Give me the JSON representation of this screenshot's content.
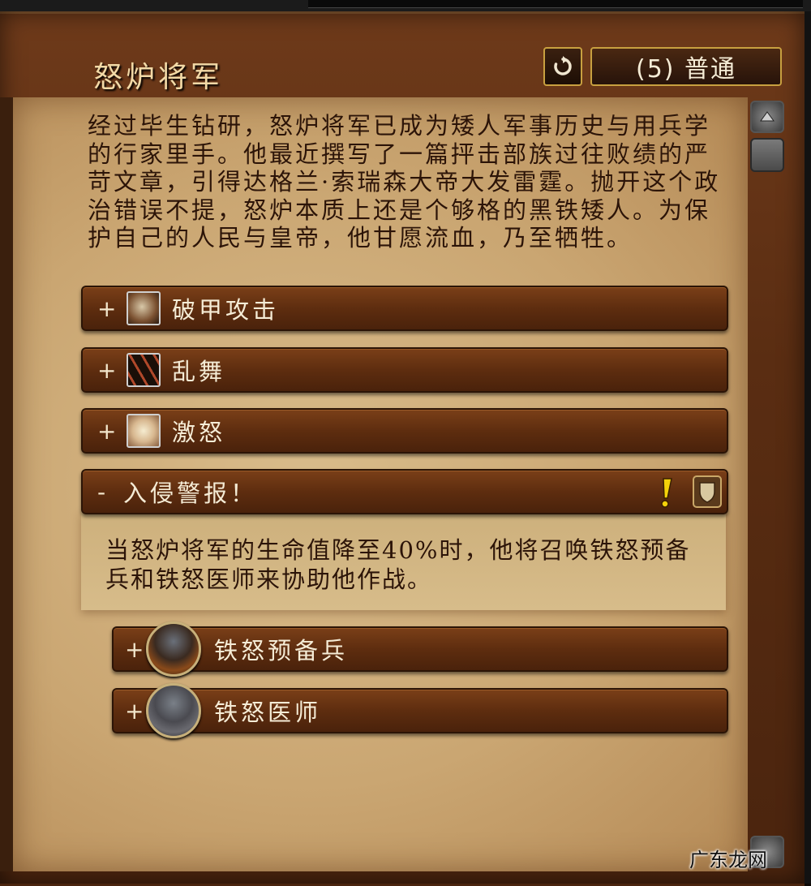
{
  "header": {
    "title": "怒炉将军",
    "difficulty_label": "(5) 普通",
    "reset_icon": "reset-arrow-icon"
  },
  "description": "经过毕生钻研，怒炉将军已成为矮人军事历史与用兵学的行家里手。他最近撰写了一篇抨击部族过往败绩的严苛文章，引得达格兰·索瑞森大帝大发雷霆。抛开这个政治错误不提，怒炉本质上还是个够格的黑铁矮人。为保护自己的人民与皇帝，他甘愿流血，乃至牺牲。",
  "abilities": [
    {
      "toggle": "+",
      "label": "破甲攻击",
      "icon": "sunder-armor-icon"
    },
    {
      "toggle": "+",
      "label": "乱舞",
      "icon": "flurry-claws-icon"
    },
    {
      "toggle": "+",
      "label": "激怒",
      "icon": "enrage-icon"
    }
  ],
  "expanded_section": {
    "toggle": "-",
    "label": "入侵警报！",
    "alert_icon": "exclamation-icon",
    "role_icon": "tank-shield-icon",
    "body": "当怒炉将军的生命值降至40%时，他将召唤铁怒预备兵和铁怒医师来协助他作战。",
    "sub_entries": [
      {
        "toggle": "+",
        "label": "铁怒预备兵",
        "icon": "dwarf-reserve-portrait"
      },
      {
        "toggle": "+",
        "label": "铁怒医师",
        "icon": "dwarf-medic-portrait"
      }
    ]
  },
  "watermark": "广东龙网"
}
